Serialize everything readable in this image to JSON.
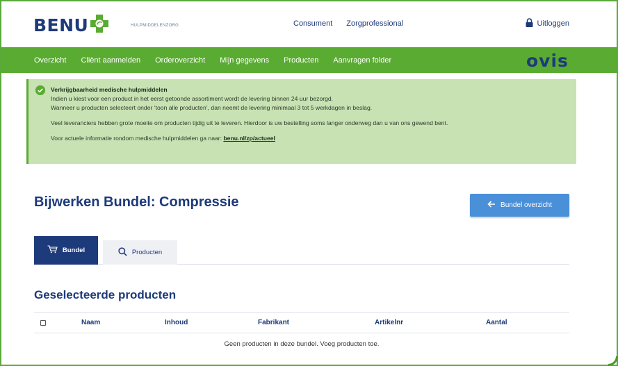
{
  "header": {
    "logo_text": "BENU",
    "logo_subtitle": "HULPMIDDELENZORG",
    "links": [
      "Consument",
      "Zorgprofessional"
    ],
    "logout_label": "Uitloggen",
    "brand_color": "#1d3a7a"
  },
  "nav": {
    "items": [
      "Overzicht",
      "Cliënt aanmelden",
      "Orderoverzicht",
      "Mijn gegevens",
      "Producten",
      "Aanvragen folder"
    ],
    "partner_logo": "OVIS",
    "background": "#5aab32"
  },
  "alert": {
    "title": "Verkrijgbaarheid medische hulpmiddelen",
    "line1": "Indien u kiest voor een product in het eerst getoonde assortiment wordt de levering binnen 24 uur bezorgd.",
    "line2": "Wanneer u producten selecteert onder ‘toon alle producten’, dan neemt de levering minimaal 3 tot 5 werkdagen in beslag.",
    "line3": "Veel leveranciers hebben grote moeite om producten tijdig uit te leveren. Hierdoor is uw bestelling soms langer onderweg dan u van ons gewend bent.",
    "line4_prefix": "Voor actuele informatie rondom medische hulpmiddelen ga naar: ",
    "link_text": "benu.nl/zp/actueel",
    "icon": "check-circle-icon"
  },
  "page": {
    "title": "Bijwerken Bundel: Compressie",
    "back_button": "Bundel overzicht"
  },
  "tabs": [
    {
      "label": "Bundel",
      "icon": "cart-icon",
      "active": true
    },
    {
      "label": "Producten",
      "icon": "search-icon",
      "active": false
    }
  ],
  "section": {
    "title": "Geselecteerde producten",
    "columns": [
      "Naam",
      "Inhoud",
      "Fabrikant",
      "Artikelnr",
      "Aantal"
    ],
    "empty_message": "Geen producten in deze bundel. Voeg producten toe."
  }
}
